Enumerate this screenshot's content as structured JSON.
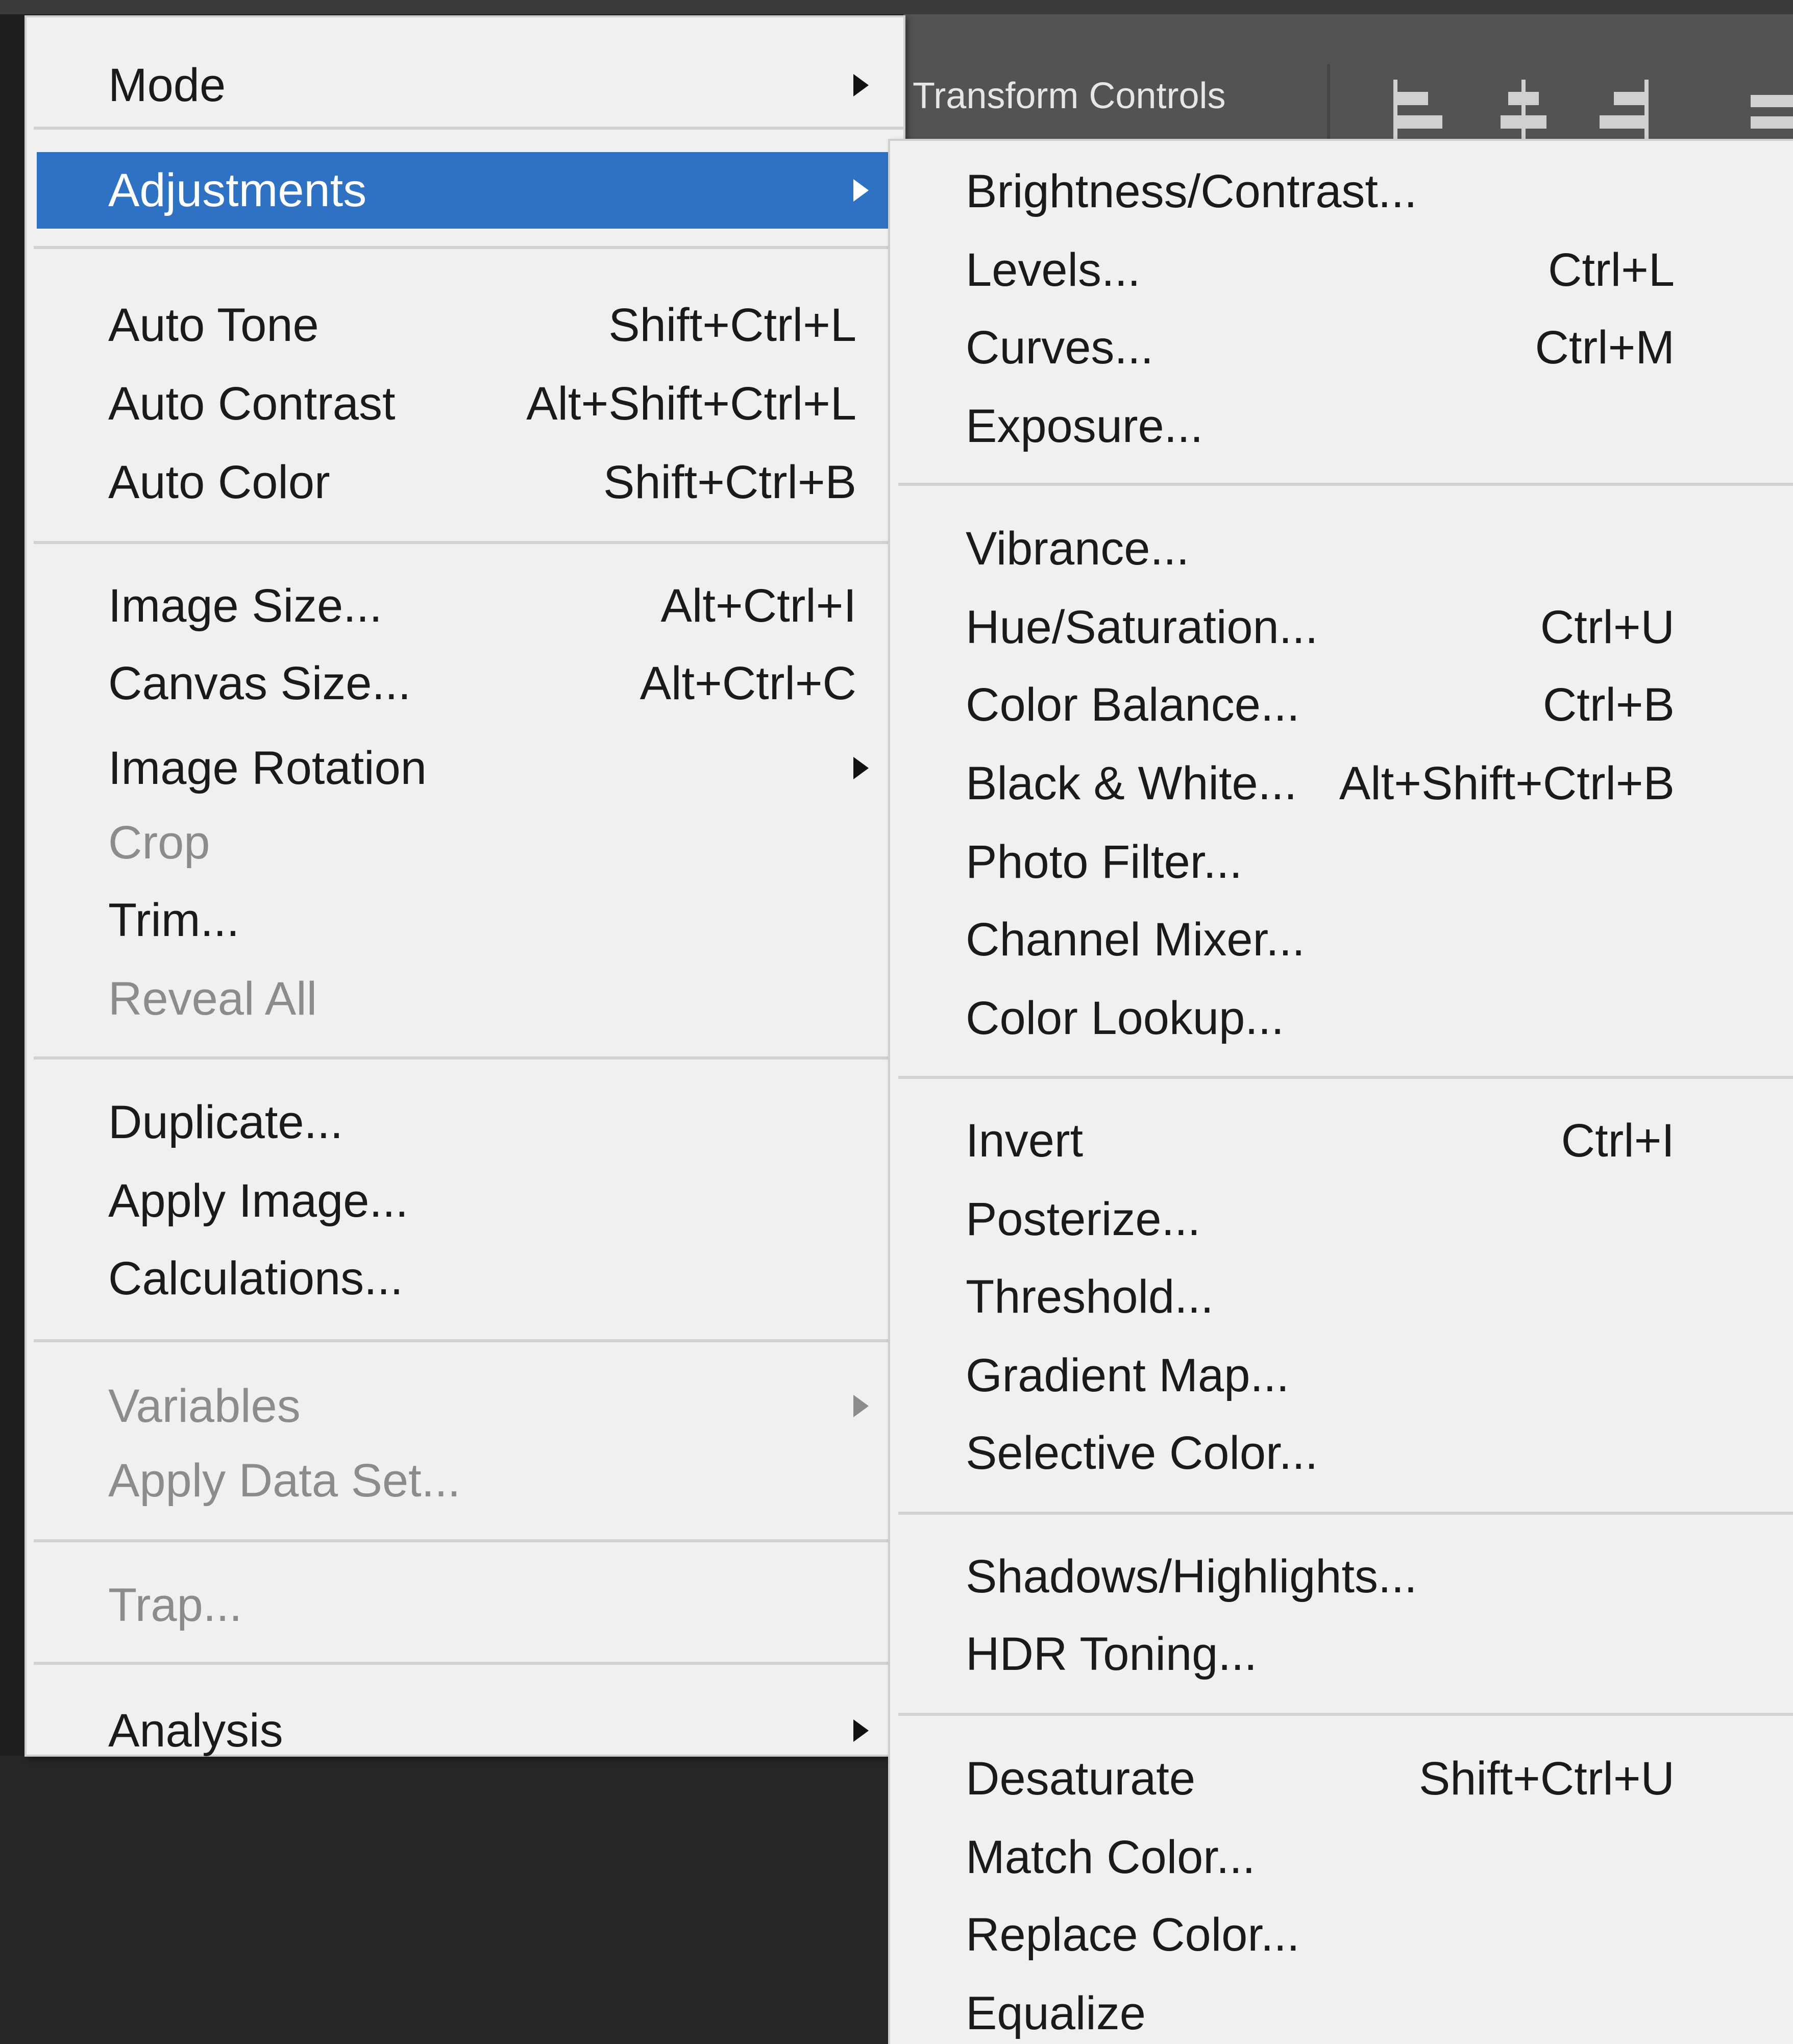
{
  "options_bar": {
    "label": "Transform Controls",
    "icons": [
      "align-left-edges-icon",
      "align-horizontal-centers-icon",
      "align-right-edges-icon",
      "distribute-icon"
    ]
  },
  "menu": {
    "items": [
      {
        "label": "Mode",
        "shortcut": "",
        "submenu": true,
        "disabled": false
      },
      {
        "label": "Adjustments",
        "shortcut": "",
        "submenu": true,
        "disabled": false,
        "selected": true
      },
      {
        "label": "Auto Tone",
        "shortcut": "Shift+Ctrl+L"
      },
      {
        "label": "Auto Contrast",
        "shortcut": "Alt+Shift+Ctrl+L"
      },
      {
        "label": "Auto Color",
        "shortcut": "Shift+Ctrl+B"
      },
      {
        "label": "Image Size...",
        "shortcut": "Alt+Ctrl+I"
      },
      {
        "label": "Canvas Size...",
        "shortcut": "Alt+Ctrl+C"
      },
      {
        "label": "Image Rotation",
        "shortcut": "",
        "submenu": true
      },
      {
        "label": "Crop",
        "shortcut": "",
        "disabled": true
      },
      {
        "label": "Trim...",
        "shortcut": ""
      },
      {
        "label": "Reveal All",
        "shortcut": "",
        "disabled": true
      },
      {
        "label": "Duplicate...",
        "shortcut": ""
      },
      {
        "label": "Apply Image...",
        "shortcut": ""
      },
      {
        "label": "Calculations...",
        "shortcut": ""
      },
      {
        "label": "Variables",
        "shortcut": "",
        "submenu": true,
        "disabled": true
      },
      {
        "label": "Apply Data Set...",
        "shortcut": "",
        "disabled": true
      },
      {
        "label": "Trap...",
        "shortcut": "",
        "disabled": true
      },
      {
        "label": "Analysis",
        "shortcut": "",
        "submenu": true
      }
    ]
  },
  "submenu": {
    "items": [
      {
        "label": "Brightness/Contrast...",
        "shortcut": ""
      },
      {
        "label": "Levels...",
        "shortcut": "Ctrl+L"
      },
      {
        "label": "Curves...",
        "shortcut": "Ctrl+M"
      },
      {
        "label": "Exposure...",
        "shortcut": ""
      },
      {
        "label": "Vibrance...",
        "shortcut": ""
      },
      {
        "label": "Hue/Saturation...",
        "shortcut": "Ctrl+U"
      },
      {
        "label": "Color Balance...",
        "shortcut": "Ctrl+B"
      },
      {
        "label": "Black & White...",
        "shortcut": "Alt+Shift+Ctrl+B"
      },
      {
        "label": "Photo Filter...",
        "shortcut": ""
      },
      {
        "label": "Channel Mixer...",
        "shortcut": ""
      },
      {
        "label": "Color Lookup...",
        "shortcut": ""
      },
      {
        "label": "Invert",
        "shortcut": "Ctrl+I"
      },
      {
        "label": "Posterize...",
        "shortcut": ""
      },
      {
        "label": "Threshold...",
        "shortcut": ""
      },
      {
        "label": "Gradient Map...",
        "shortcut": ""
      },
      {
        "label": "Selective Color...",
        "shortcut": ""
      },
      {
        "label": "Shadows/Highlights...",
        "shortcut": ""
      },
      {
        "label": "HDR Toning...",
        "shortcut": ""
      },
      {
        "label": "Desaturate",
        "shortcut": "Shift+Ctrl+U"
      },
      {
        "label": "Match Color...",
        "shortcut": ""
      },
      {
        "label": "Replace Color...",
        "shortcut": ""
      },
      {
        "label": "Equalize",
        "shortcut": ""
      }
    ]
  },
  "colors": {
    "menu_bg": "#f0f0f0",
    "highlight": "#2f72c4",
    "text": "#1a1a1a",
    "disabled_text": "#8c8c8c",
    "options_bar_bg": "#535353"
  }
}
